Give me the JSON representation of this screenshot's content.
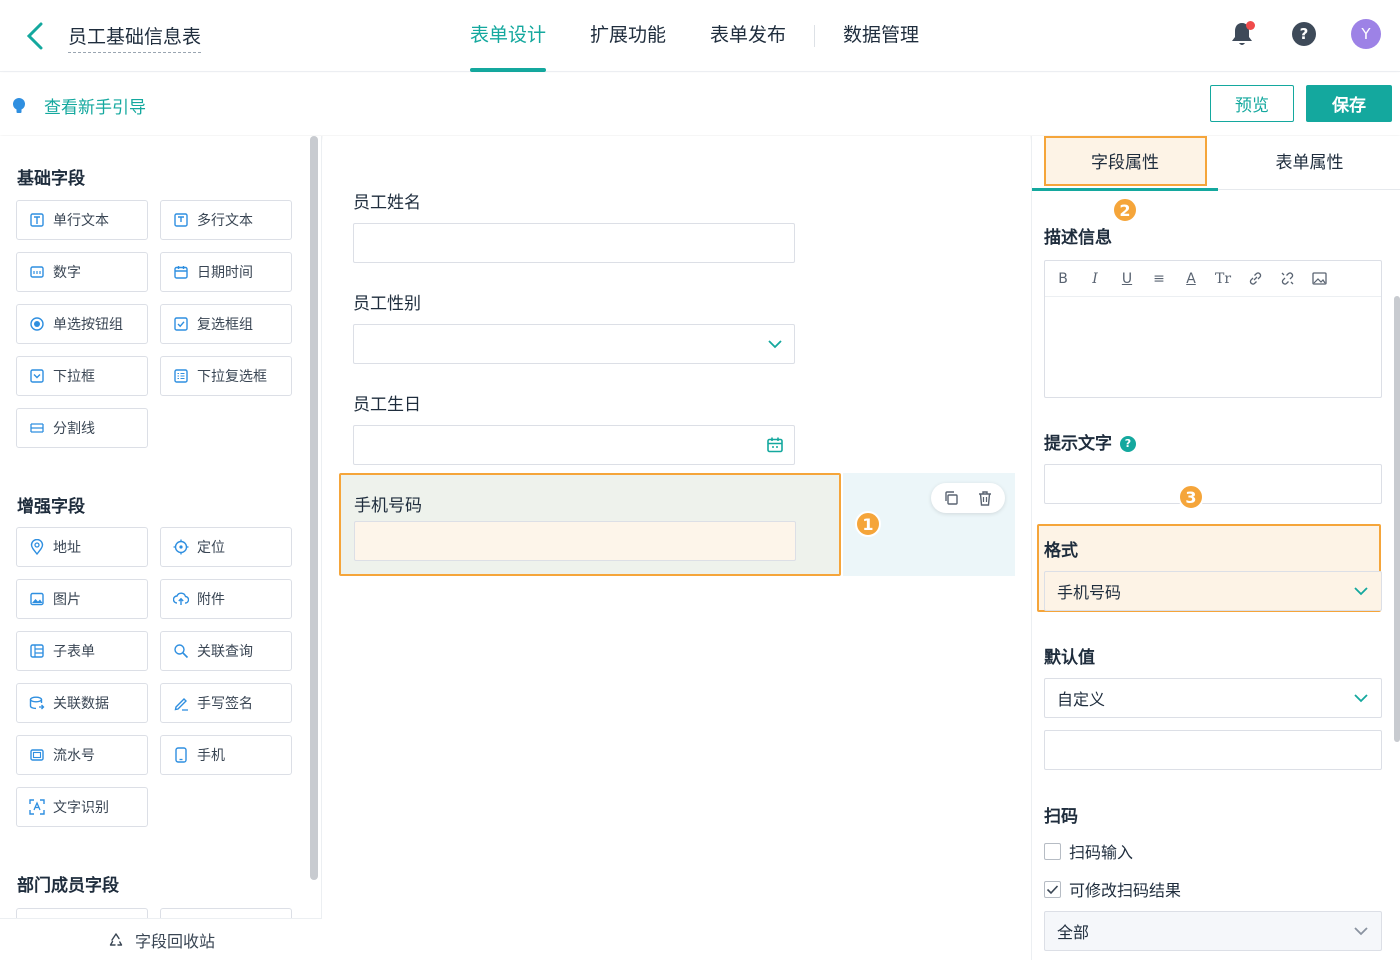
{
  "header": {
    "form_title": "员工基础信息表",
    "tabs": [
      {
        "label": "表单设计"
      },
      {
        "label": "扩展功能"
      },
      {
        "label": "表单发布"
      },
      {
        "label": "数据管理"
      }
    ],
    "avatar_letter": "Y",
    "help_glyph": "?"
  },
  "subbar": {
    "guide_label": "查看新手引导",
    "preview_label": "预览",
    "save_label": "保存"
  },
  "left_panel": {
    "groups": [
      {
        "title": "基础字段",
        "items": [
          "单行文本",
          "多行文本",
          "数字",
          "日期时间",
          "单选按钮组",
          "复选框组",
          "下拉框",
          "下拉复选框",
          "分割线"
        ]
      },
      {
        "title": "增强字段",
        "items": [
          "地址",
          "定位",
          "图片",
          "附件",
          "子表单",
          "关联查询",
          "关联数据",
          "手写签名",
          "流水号",
          "手机",
          "文字识别"
        ]
      },
      {
        "title": "部门成员字段",
        "items": []
      }
    ],
    "recycle_label": "字段回收站"
  },
  "canvas": {
    "fields": [
      {
        "label": "员工姓名",
        "type": "text"
      },
      {
        "label": "员工性别",
        "type": "select"
      },
      {
        "label": "员工生日",
        "type": "date"
      },
      {
        "label": "手机号码",
        "type": "phone"
      }
    ],
    "badge_1": "1"
  },
  "right_panel": {
    "tab_field": "字段属性",
    "tab_form": "表单属性",
    "badge_2": "2",
    "badge_3": "3",
    "desc_label": "描述信息",
    "editor_tools": [
      "B",
      "I",
      "U",
      "≡",
      "A",
      "Tr",
      "link",
      "unlink",
      "image"
    ],
    "hint_label": "提示文字",
    "format_label": "格式",
    "format_value": "手机号码",
    "default_label": "默认值",
    "default_value": "自定义",
    "scan_label": "扫码",
    "scan_input": "扫码输入",
    "scan_modify": "可修改扫码结果",
    "scan_range": "全部"
  },
  "colors": {
    "accent": "#14a89e",
    "highlight": "#f5a53a",
    "icon_blue": "#2f8fe0"
  }
}
